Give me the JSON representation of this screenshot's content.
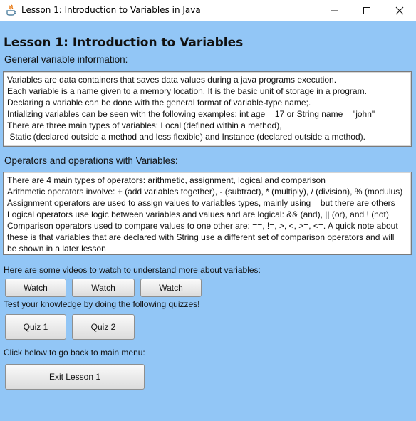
{
  "window": {
    "title": "Lesson 1: Introduction to Variables in Java",
    "controls": [
      "minimize-icon",
      "maximize-icon",
      "close-icon"
    ],
    "app_icon": "java-icon"
  },
  "lesson": {
    "heading": "Lesson 1: Introduction to Variables"
  },
  "general": {
    "label": "General variable information:",
    "lines": [
      "Variables are data containers that saves data values during a java programs execution.",
      "Each variable is a name given to a memory location. It is the basic unit of storage in a program.",
      "Declaring a variable can be done with the general format of variable-type name;.",
      "Intializing variables can be seen with the following examples: int age = 17 or String name = \"john\"",
      "There are three main types of variables: Local (defined within a method),",
      " Static (declared outside a method and less flexible) and Instance (declared outside a method)."
    ]
  },
  "operators": {
    "label": "Operators and operations with Variables:",
    "lines": [
      "There are 4 main types of operators: arithmetic, assignment, logical and comparison",
      "Arithmetic operators involve: + (add variables together), - (subtract), * (multiply), / (division), % (modulus)",
      "Assignment operators are used to assign values to variables types, mainly using = but there are others",
      "Logical operators use logic between variables and values and are logical: && (and), || (or), and ! (not)",
      "Comparison operators used to compare values to one other are: ==, !=, >, <, >=, <=. A quick note about",
      "these is that variables that are declared with String use a different set of comparison operators and will",
      "be shown in a later lesson"
    ]
  },
  "videos": {
    "text": "Here are some videos to watch to understand more about variables:",
    "buttons": [
      "Watch",
      "Watch",
      "Watch"
    ]
  },
  "quizzes": {
    "text": "Test your knowledge by doing the following quizzes!",
    "buttons": [
      "Quiz 1",
      "Quiz 2"
    ]
  },
  "exit": {
    "text": "Click below to go back to main menu:",
    "button": "Exit Lesson 1"
  },
  "colors": {
    "background": "#92c6f6",
    "titlebar": "#ffffff"
  }
}
